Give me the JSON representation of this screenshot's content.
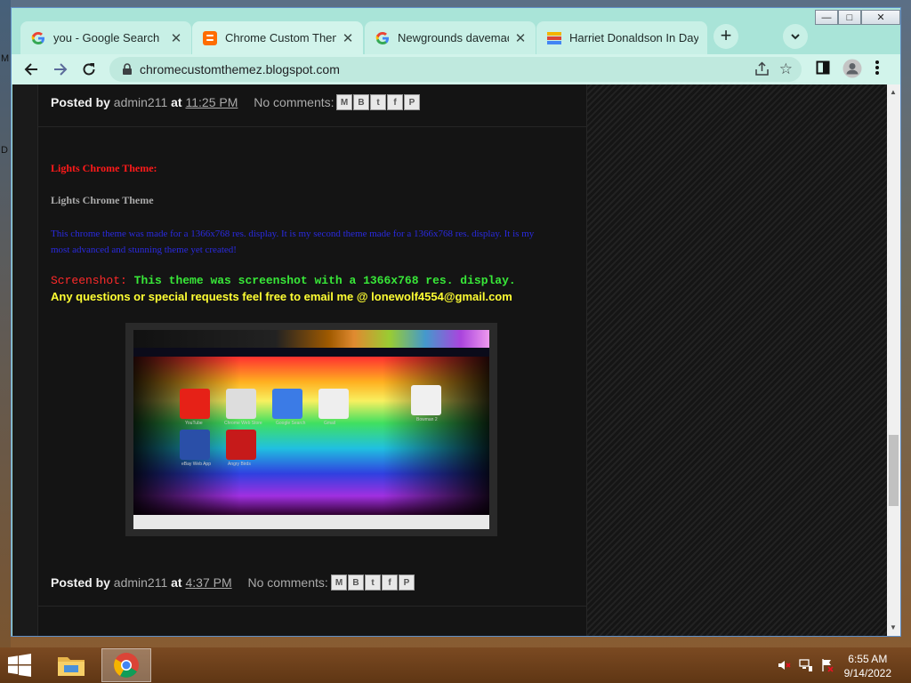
{
  "desktop": {
    "left_glyphs": [
      "M",
      "D"
    ]
  },
  "window": {
    "tabs": [
      {
        "title": "you - Google Search",
        "favicon": "google-icon"
      },
      {
        "title": "Chrome Custom Themez: Lights",
        "favicon": "blogger-icon"
      },
      {
        "title": "Newgrounds davemadson",
        "favicon": "google-icon"
      },
      {
        "title": "Harriet Donaldson In Dayton,",
        "favicon": "colorful-icon"
      }
    ],
    "new_tab_label": "+",
    "controls": {
      "minimize": "—",
      "maximize": "□",
      "close": "✕"
    }
  },
  "toolbar": {
    "url": "chromecustomthemez.blogspot.com"
  },
  "page": {
    "footer_top": {
      "posted_by_label": "Posted by",
      "author": "admin211",
      "at_label": "at",
      "time": "11:25 PM",
      "comments": "No comments:"
    },
    "post": {
      "title": "Lights Chrome Theme:",
      "subtitle": "Lights Chrome Theme",
      "description": "This chrome theme was made for a 1366x768 res. display. It is my second theme made for a 1366x768 res. display. It is my most advanced and stunning theme yet created!",
      "screenshot_label": "Screenshot:",
      "screenshot_text": "This theme was screenshot with a 1366x768 res. display.",
      "email_line": "Any questions or special requests feel free to email me @ lonewolf4554@gmail.com"
    },
    "screenshot_apps": [
      {
        "label": "YouTube",
        "color": "#e62117"
      },
      {
        "label": "Chrome Web Store",
        "color": "#dddddd"
      },
      {
        "label": "Google Search",
        "color": "#3b7be6"
      },
      {
        "label": "Gmail",
        "color": "#eeeeee"
      },
      {
        "label": "Bowman 2",
        "color": "#f0f0f0"
      },
      {
        "label": "eBay Web App",
        "color": "#2a4fa8"
      },
      {
        "label": "Angry Birds",
        "color": "#c61a1a"
      }
    ],
    "footer_bottom": {
      "posted_by_label": "Posted by",
      "author": "admin211",
      "at_label": "at",
      "time": "4:37 PM",
      "comments": "No comments:"
    }
  },
  "taskbar": {
    "apps": [
      "file-explorer",
      "chrome"
    ],
    "time": "6:55 AM",
    "date": "9/14/2022"
  }
}
